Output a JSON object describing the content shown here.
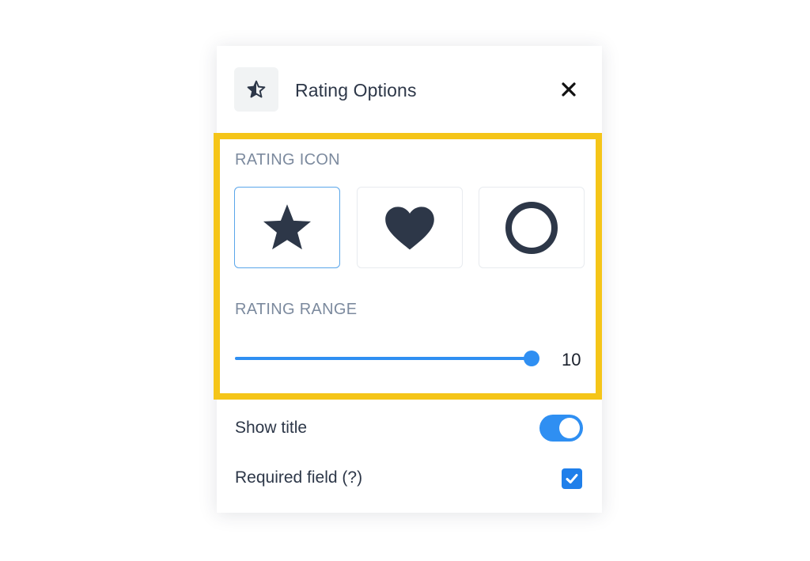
{
  "header": {
    "title": "Rating Options",
    "icon": "half-star-icon",
    "close_icon": "close-icon"
  },
  "rating_icon": {
    "label": "RATING ICON",
    "options": [
      {
        "icon": "star-icon",
        "selected": true
      },
      {
        "icon": "heart-icon",
        "selected": false
      },
      {
        "icon": "circle-icon",
        "selected": false
      }
    ]
  },
  "rating_range": {
    "label": "RATING RANGE",
    "value": "10",
    "fraction": 1.0
  },
  "show_title": {
    "label": "Show title",
    "enabled": true
  },
  "required_field": {
    "label": "Required field (?)",
    "checked": true
  },
  "colors": {
    "accent": "#2f8ff2",
    "highlight_border": "#f5c518",
    "icon_dark": "#2d3748",
    "label_muted": "#7c8a9e"
  }
}
